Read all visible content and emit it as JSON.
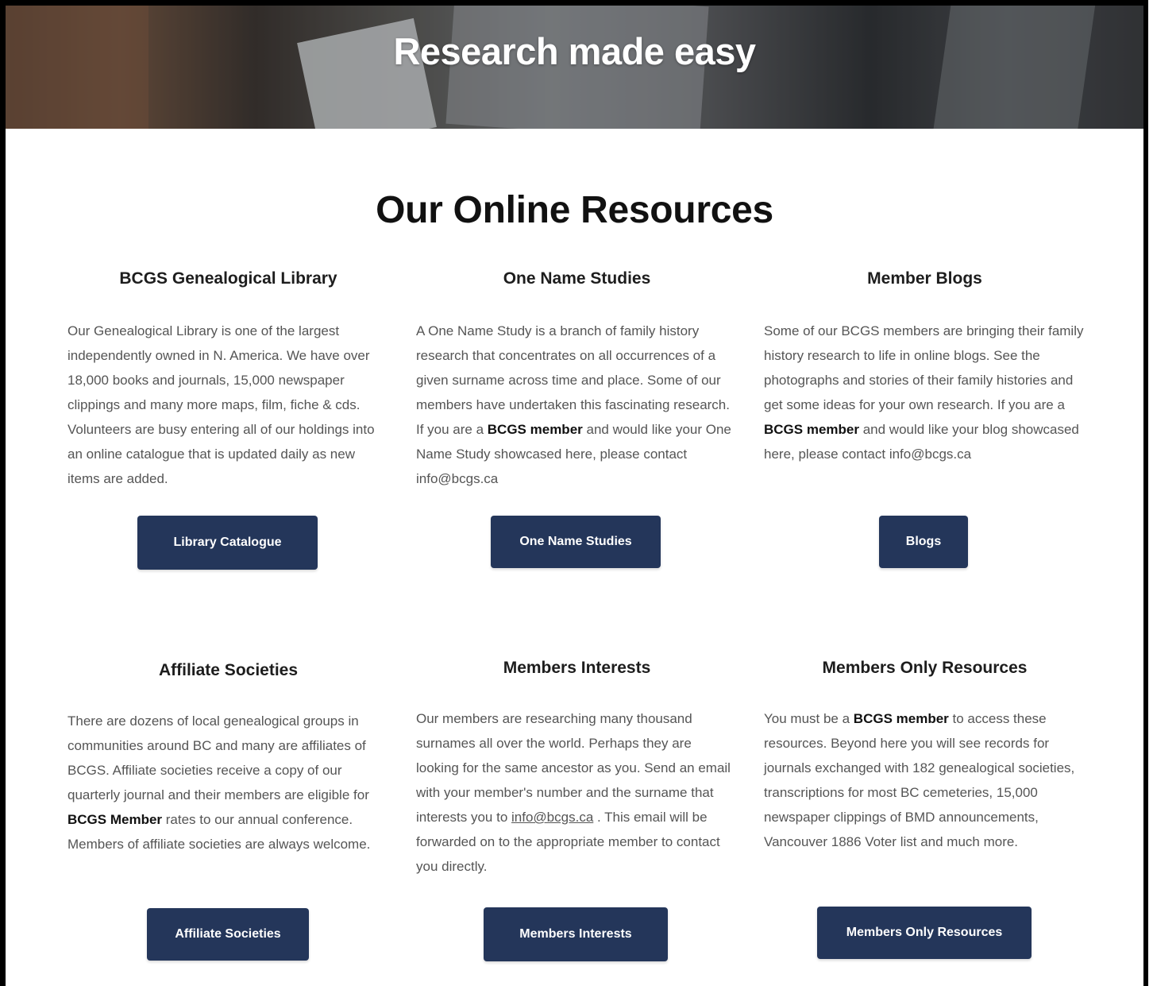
{
  "hero": {
    "title": "Research made easy"
  },
  "section_title": "Our Online Resources",
  "cards": [
    {
      "title": "BCGS Genealogical Library",
      "text": "Our Genealogical Library is one of the largest independently owned in N. America. We have over 18,000 books and journals, 15,000 newspaper clippings and many more maps, film, fiche & cds. Volunteers are busy entering all of our holdings into an online catalogue that is updated daily as new items are added.",
      "button": "Library Catalogue"
    },
    {
      "title": "One Name Studies",
      "text_before": "A One Name Study is a branch of family history research that concentrates on all occurrences of a given surname across time and place. Some of our members have undertaken this fascinating research. If you are a ",
      "bold": "BCGS member",
      "text_after": " and would like your One Name Study showcased here, please contact info@bcgs.ca",
      "button": "One Name Studies"
    },
    {
      "title": "Member Blogs",
      "text_before": "Some of our BCGS members are bringing their family history research to life in online blogs. See the photographs and stories of their family histories and get some ideas for your own research. If you are a ",
      "bold": "BCGS member",
      "text_after": " and would like your blog showcased here, please contact info@bcgs.ca",
      "button": "Blogs"
    },
    {
      "title": "Affiliate Societies",
      "text_before": "There are dozens of local genealogical groups in communities around BC and many are affiliates of BCGS.  Affiliate societies receive a copy of our quarterly journal and their members are eligible for ",
      "bold": "BCGS Member",
      "text_after": " rates to our annual conference.  Members of affiliate societies are always welcome.",
      "button": "Affiliate Societies"
    },
    {
      "title": "Members Interests",
      "text_before": "Our members are researching many thousand surnames all over the world.  Perhaps they are looking for the same ancestor as you.  Send an email with your member's number and the surname that interests you to ",
      "link": "info@bcgs.ca",
      "text_after": " . This email will be forwarded on to the appropriate member to contact you directly.",
      "button": "Members Interests"
    },
    {
      "title": "Members Only Resources",
      "text_before": "You must be a ",
      "bold": "BCGS member",
      "text_after": " to access these resources.  Beyond here you will see records for journals exchanged with 182 genealogical societies, transcriptions for most BC cemeteries, 15,000 newspaper clippings of BMD announcements, Vancouver 1886 Voter list and much more.",
      "button": "Members Only Resources"
    }
  ]
}
